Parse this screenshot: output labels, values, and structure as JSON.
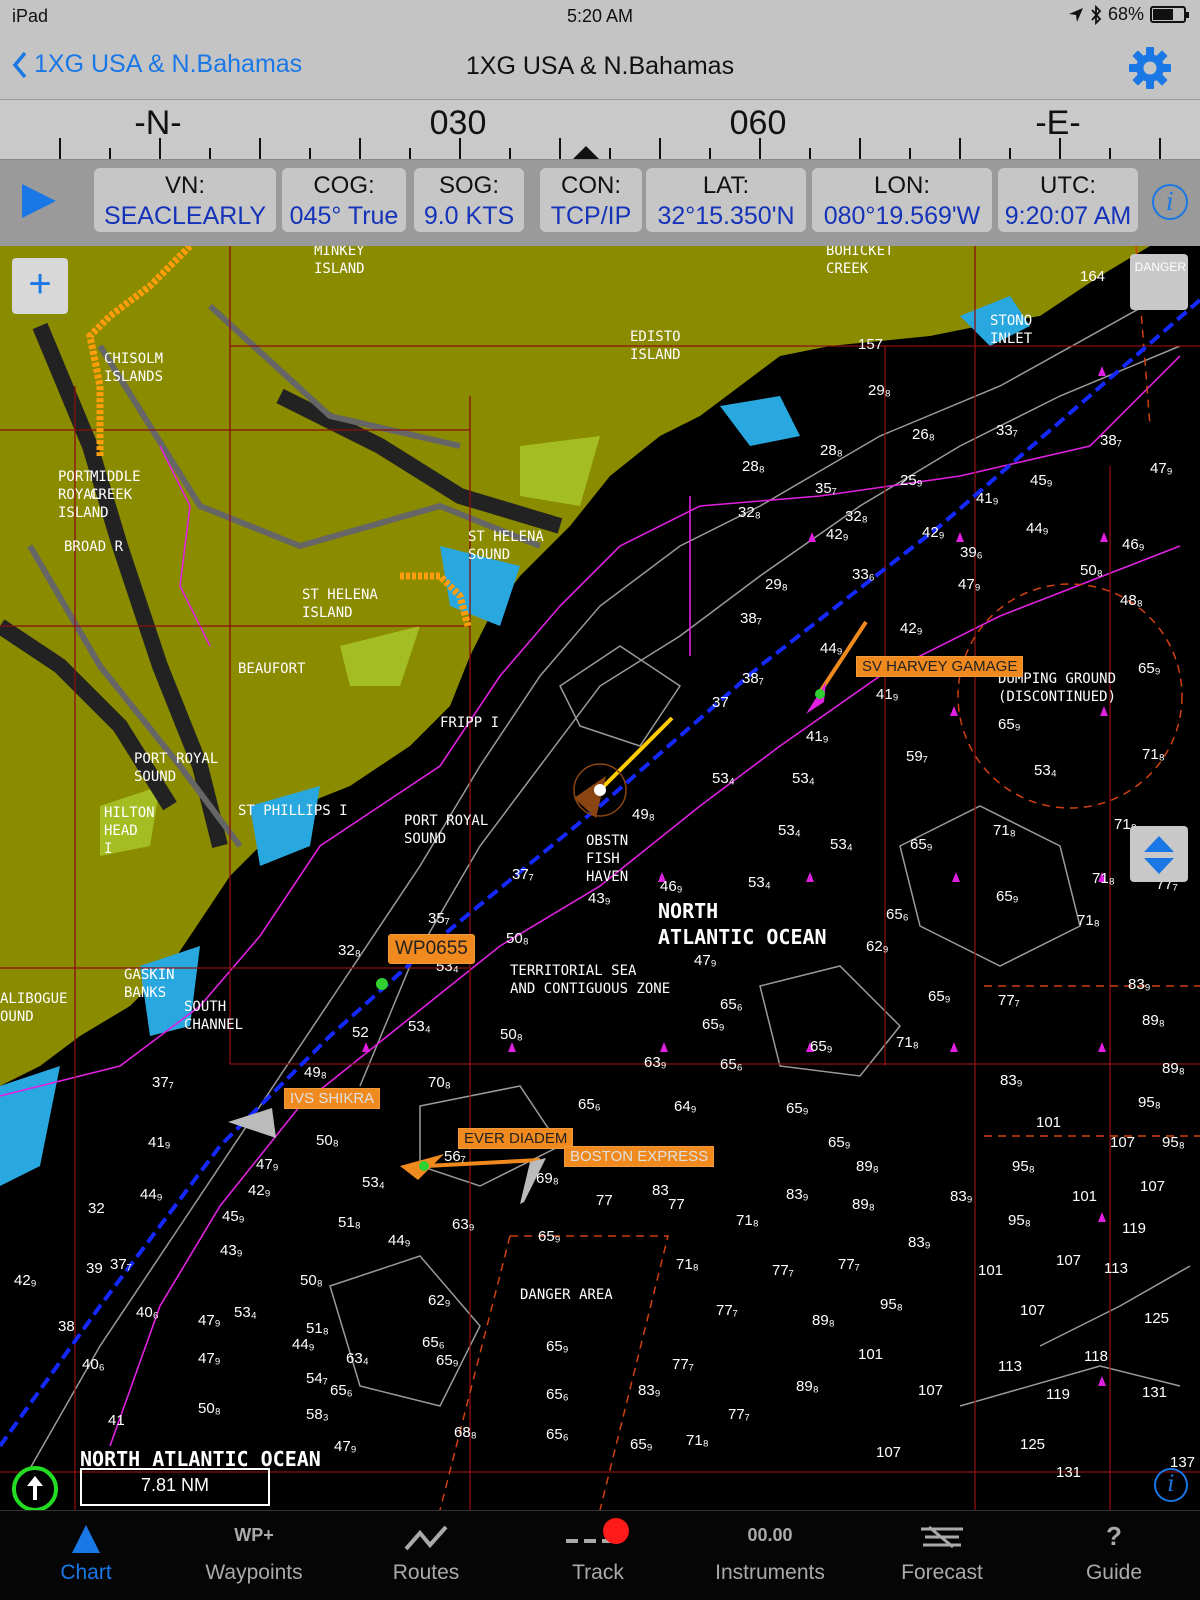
{
  "status": {
    "device": "iPad",
    "time": "5:20 AM",
    "battery": "68%",
    "battery_level": 0.68
  },
  "nav": {
    "back_label": "1XG USA & N.Bahamas",
    "title": "1XG USA & N.Bahamas"
  },
  "compass": {
    "labels": [
      "-N-",
      "030",
      "060",
      "-E-"
    ]
  },
  "info": {
    "cells": [
      {
        "label": "VN:",
        "value": "SEACLEARLY"
      },
      {
        "label": "COG:",
        "value": "045° True"
      },
      {
        "label": "SOG:",
        "value": "9.0 KTS"
      },
      {
        "label": "CON:",
        "value": "TCP/IP"
      },
      {
        "label": "LAT:",
        "value": "32°15.350'N"
      },
      {
        "label": "LON:",
        "value": "080°19.569'W"
      },
      {
        "label": "UTC:",
        "value": "9:20:07 AM"
      }
    ]
  },
  "chart": {
    "zoom_label": "+",
    "danger_label": "DANGER",
    "scale": "7.81 NM",
    "info_label": "i",
    "places": {
      "minkey": "MINKEY\nISLAND",
      "bohicket": "BOHICKET\nCREEK",
      "stono": "STONO\nINLET",
      "edisto": "EDISTO\nISLAND",
      "chisolm": "CHISOLM\nISLANDS",
      "port_royal_island": "PORT\nROYAL\nISLAND",
      "middle_creek": "MIDDLE\nCREEK",
      "broad": "BROAD R",
      "st_helena_sound": "ST HELENA\nSOUND",
      "st_helena_island": "ST HELENA\nISLAND",
      "beaufort": "BEAUFORT",
      "fripp": "FRIPP I",
      "port_royal_sound_land": "PORT ROYAL\nSOUND",
      "hilton_head": "HILTON\nHEAD\nI",
      "st_phillips": "ST PHILLIPS I",
      "port_royal_sound": "PORT ROYAL\nSOUND",
      "obstn": "OBSTN\nFISH\nHAVEN",
      "north_atlantic": "NORTH\nATLANTIC OCEAN",
      "territorial": "TERRITORIAL SEA\nAND CONTIGUOUS ZONE",
      "gaskin": "GASKIN\nBANKS",
      "south_channel": "SOUTH\nCHANNEL",
      "dumping": "DUMPING GROUND\n(DISCONTINUED)",
      "danger_area": "DANGER AREA",
      "calibogue": "ALIBOGUE\nOUND",
      "north_atlantic_bottom": "NORTH ATLANTIC OCEAN"
    },
    "targets": {
      "harvey": "SV HARVEY GAMAGE",
      "waypoint": "WP0655",
      "shikra": "IVS SHIKRA",
      "ever": "EVER DIADEM",
      "boston": "BOSTON EXPRESS"
    },
    "soundings": [
      [
        "164",
        1080,
        22
      ],
      [
        "157",
        858,
        90
      ],
      [
        "29₈",
        868,
        136
      ],
      [
        "26₈",
        912,
        180
      ],
      [
        "33₇",
        996,
        176
      ],
      [
        "38₇",
        1100,
        186
      ],
      [
        "28₈",
        742,
        212
      ],
      [
        "28₈",
        820,
        196
      ],
      [
        "35₇",
        815,
        234
      ],
      [
        "25₉",
        900,
        226
      ],
      [
        "41₉",
        976,
        244
      ],
      [
        "45₉",
        1030,
        226
      ],
      [
        "47₉",
        1150,
        214
      ],
      [
        "32₈",
        738,
        258
      ],
      [
        "32₈",
        845,
        262
      ],
      [
        "42₉",
        826,
        280
      ],
      [
        "42₉",
        922,
        278
      ],
      [
        "44₉",
        1026,
        274
      ],
      [
        "46₉",
        1122,
        290
      ],
      [
        "39₆",
        960,
        298
      ],
      [
        "29₈",
        765,
        330
      ],
      [
        "33₆",
        852,
        320
      ],
      [
        "47₉",
        958,
        330
      ],
      [
        "50₈",
        1080,
        316
      ],
      [
        "48₈",
        1120,
        346
      ],
      [
        "38₇",
        740,
        364
      ],
      [
        "44₉",
        820,
        394
      ],
      [
        "42₉",
        900,
        374
      ],
      [
        "38₇",
        742,
        424
      ],
      [
        "41₉",
        876,
        440
      ],
      [
        "65₉",
        1138,
        414
      ],
      [
        "37",
        712,
        448
      ],
      [
        "65₉",
        998,
        470
      ],
      [
        "41₉",
        806,
        482
      ],
      [
        "59₇",
        906,
        502
      ],
      [
        "71₈",
        1142,
        500
      ],
      [
        "53₄",
        712,
        524
      ],
      [
        "53₄",
        792,
        524
      ],
      [
        "53₄",
        1034,
        516
      ],
      [
        "49₈",
        632,
        560
      ],
      [
        "53₄",
        778,
        576
      ],
      [
        "53₄",
        830,
        590
      ],
      [
        "65₉",
        910,
        590
      ],
      [
        "71₈",
        993,
        576
      ],
      [
        "71₈",
        1114,
        570
      ],
      [
        "37₇",
        512,
        620
      ],
      [
        "46₉",
        660,
        632
      ],
      [
        "53₄",
        748,
        628
      ],
      [
        "65₉",
        996,
        642
      ],
      [
        "71₈",
        1092,
        624
      ],
      [
        "77₇",
        1156,
        630
      ],
      [
        "43₉",
        588,
        644
      ],
      [
        "65₆",
        886,
        660
      ],
      [
        "71₈",
        1077,
        666
      ],
      [
        "35₇",
        428,
        664
      ],
      [
        "32₈",
        338,
        696
      ],
      [
        "50₈",
        506,
        684
      ],
      [
        "53₄",
        436,
        712
      ],
      [
        "47₉",
        694,
        706
      ],
      [
        "62₉",
        866,
        692
      ],
      [
        "83₉",
        1128,
        730
      ],
      [
        "65₉",
        928,
        742
      ],
      [
        "77₇",
        998,
        746
      ],
      [
        "89₈",
        1142,
        766
      ],
      [
        "65₆",
        720,
        750
      ],
      [
        "65₉",
        702,
        770
      ],
      [
        "53₄",
        408,
        772
      ],
      [
        "52",
        352,
        778
      ],
      [
        "50₈",
        500,
        780
      ],
      [
        "65₉",
        810,
        792
      ],
      [
        "71₈",
        896,
        788
      ],
      [
        "63₉",
        644,
        808
      ],
      [
        "65₆",
        720,
        810
      ],
      [
        "49₈",
        304,
        818
      ],
      [
        "70₈",
        428,
        828
      ],
      [
        "83₉",
        1000,
        826
      ],
      [
        "89₈",
        1162,
        814
      ],
      [
        "65₆",
        578,
        850
      ],
      [
        "64₉",
        674,
        852
      ],
      [
        "65₉",
        786,
        854
      ],
      [
        "95₈",
        1138,
        848
      ],
      [
        "37₇",
        152,
        828
      ],
      [
        "50₈",
        316,
        886
      ],
      [
        "65₉",
        828,
        888
      ],
      [
        "101",
        1036,
        868
      ],
      [
        "107",
        1110,
        888
      ],
      [
        "95₈",
        1162,
        888
      ],
      [
        "41₉",
        148,
        888
      ],
      [
        "56₇",
        444,
        902
      ],
      [
        "69₈",
        536,
        924
      ],
      [
        "89₈",
        856,
        912
      ],
      [
        "95₈",
        1012,
        912
      ],
      [
        "47₉",
        256,
        910
      ],
      [
        "53₄",
        362,
        928
      ],
      [
        "77",
        596,
        946
      ],
      [
        "83",
        652,
        936
      ],
      [
        "77",
        668,
        950
      ],
      [
        "83₉",
        786,
        940
      ],
      [
        "89₈",
        852,
        950
      ],
      [
        "83₉",
        950,
        942
      ],
      [
        "101",
        1072,
        942
      ],
      [
        "107",
        1140,
        932
      ],
      [
        "42₉",
        248,
        936
      ],
      [
        "44₉",
        140,
        940
      ],
      [
        "45₉",
        222,
        962
      ],
      [
        "51₈",
        338,
        968
      ],
      [
        "63₉",
        452,
        970
      ],
      [
        "71₈",
        736,
        966
      ],
      [
        "95₈",
        1008,
        966
      ],
      [
        "119",
        1122,
        974
      ],
      [
        "32",
        88,
        954
      ],
      [
        "44₉",
        388,
        986
      ],
      [
        "65₉",
        538,
        982
      ],
      [
        "83₉",
        908,
        988
      ],
      [
        "107",
        1056,
        1006
      ],
      [
        "113",
        1104,
        1014
      ],
      [
        "43₉",
        220,
        996
      ],
      [
        "71₈",
        676,
        1010
      ],
      [
        "77₇",
        772,
        1016
      ],
      [
        "77₇",
        838,
        1010
      ],
      [
        "101",
        978,
        1016
      ],
      [
        "42₉",
        14,
        1026
      ],
      [
        "39",
        86,
        1014
      ],
      [
        "37₇",
        110,
        1010
      ],
      [
        "50₈",
        300,
        1026
      ],
      [
        "62₉",
        428,
        1046
      ],
      [
        "51₈",
        306,
        1074
      ],
      [
        "77₇",
        716,
        1056
      ],
      [
        "89₈",
        812,
        1066
      ],
      [
        "95₈",
        880,
        1050
      ],
      [
        "107",
        1020,
        1056
      ],
      [
        "125",
        1144,
        1064
      ],
      [
        "40₆",
        136,
        1058
      ],
      [
        "47₉",
        198,
        1066
      ],
      [
        "53₄",
        234,
        1058
      ],
      [
        "65₆",
        422,
        1088
      ],
      [
        "65₉",
        546,
        1092
      ],
      [
        "44₉",
        292,
        1090
      ],
      [
        "101",
        858,
        1100
      ],
      [
        "113",
        998,
        1112
      ],
      [
        "118",
        1084,
        1102
      ],
      [
        "38",
        58,
        1072
      ],
      [
        "47₉",
        198,
        1104
      ],
      [
        "63₄",
        346,
        1104
      ],
      [
        "65₉",
        436,
        1106
      ],
      [
        "77₇",
        672,
        1110
      ],
      [
        "40₆",
        82,
        1110
      ],
      [
        "54₇",
        306,
        1124
      ],
      [
        "65₆",
        330,
        1136
      ],
      [
        "83₉",
        638,
        1136
      ],
      [
        "89₈",
        796,
        1132
      ],
      [
        "107",
        918,
        1136
      ],
      [
        "131",
        1142,
        1138
      ],
      [
        "119",
        1046,
        1140
      ],
      [
        "65₆",
        546,
        1140
      ],
      [
        "50₈",
        198,
        1154
      ],
      [
        "58₃",
        306,
        1160
      ],
      [
        "77₇",
        728,
        1160
      ],
      [
        "41",
        108,
        1166
      ],
      [
        "68₈",
        454,
        1178
      ],
      [
        "65₆",
        546,
        1180
      ],
      [
        "65₉",
        630,
        1190
      ],
      [
        "71₈",
        686,
        1186
      ],
      [
        "125",
        1020,
        1190
      ],
      [
        "107",
        876,
        1198
      ],
      [
        "47₉",
        334,
        1192
      ],
      [
        "131",
        1056,
        1218
      ],
      [
        "137",
        1170,
        1208
      ]
    ]
  },
  "tabs": [
    {
      "label": "Chart",
      "icon": "chart-icon"
    },
    {
      "label": "Waypoints",
      "icon": "waypoints-icon",
      "glyph": "WP+"
    },
    {
      "label": "Routes",
      "icon": "routes-icon"
    },
    {
      "label": "Track",
      "icon": "track-icon"
    },
    {
      "label": "Instruments",
      "icon": "instruments-icon",
      "glyph": "00.00"
    },
    {
      "label": "Forecast",
      "icon": "forecast-icon"
    },
    {
      "label": "Guide",
      "icon": "guide-icon",
      "glyph": "?"
    }
  ],
  "colors": {
    "accent": "#1a78e6",
    "land": "#8b8b00",
    "tag": "#f08a1e",
    "route": "#1428ff"
  }
}
